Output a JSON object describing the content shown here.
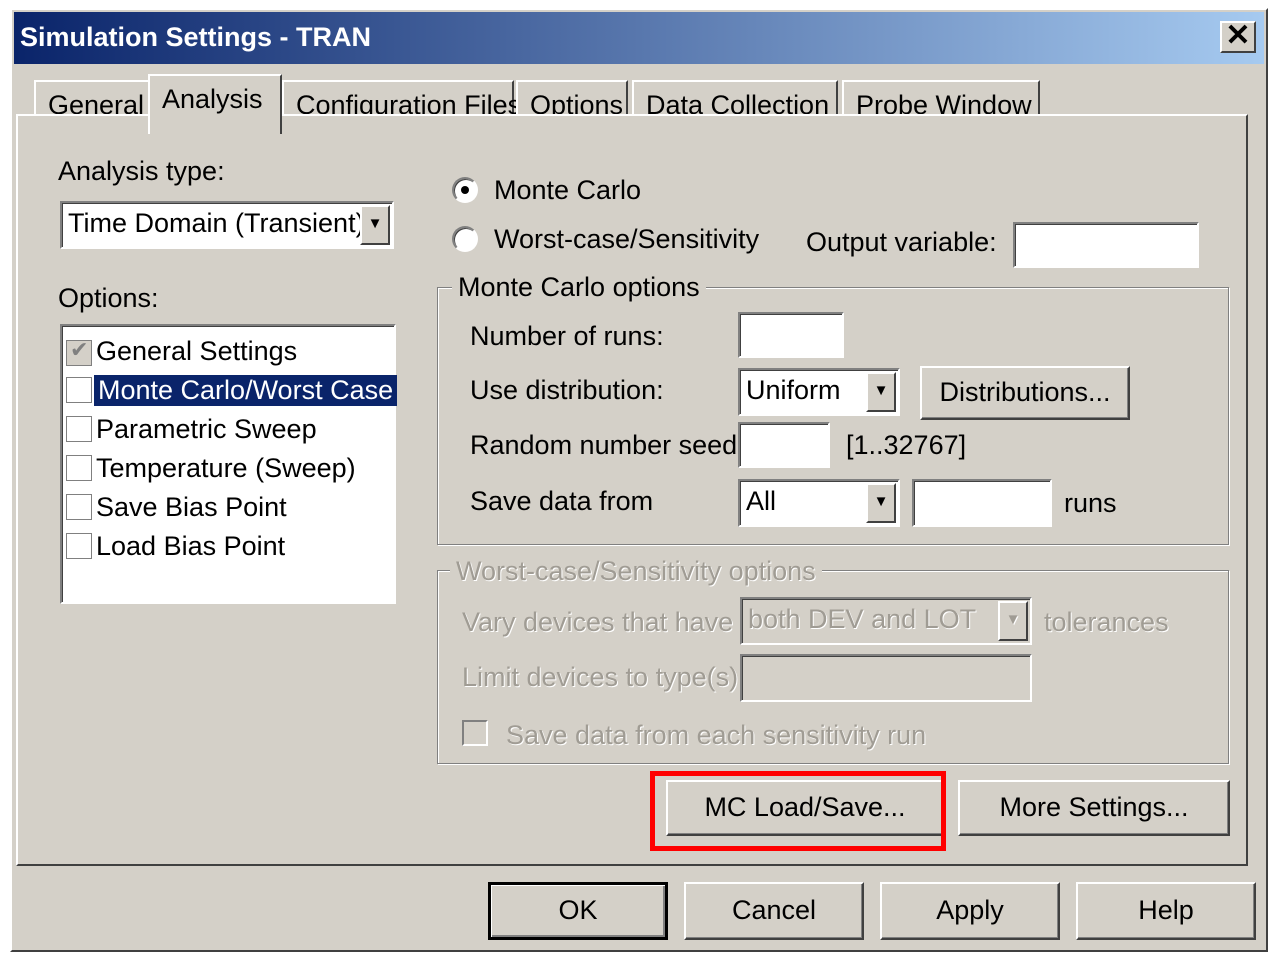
{
  "window": {
    "title": "Simulation Settings - TRAN",
    "close_glyph": "✕"
  },
  "tabs": [
    {
      "label": "General"
    },
    {
      "label": "Analysis",
      "active": true
    },
    {
      "label": "Configuration Files"
    },
    {
      "label": "Options"
    },
    {
      "label": "Data Collection"
    },
    {
      "label": "Probe Window"
    }
  ],
  "analysis_type": {
    "label": "Analysis type:",
    "value": "Time Domain (Transient)"
  },
  "options": {
    "label": "Options:",
    "items": [
      {
        "label": "General Settings",
        "checked": true,
        "disabled": true
      },
      {
        "label": "Monte Carlo/Worst Case",
        "checked": false,
        "selected": true
      },
      {
        "label": "Parametric Sweep",
        "checked": false
      },
      {
        "label": "Temperature (Sweep)",
        "checked": false
      },
      {
        "label": "Save Bias Point",
        "checked": false
      },
      {
        "label": "Load Bias Point",
        "checked": false
      }
    ]
  },
  "mode": {
    "monte_carlo": "Monte Carlo",
    "worst_case": "Worst-case/Sensitivity",
    "selected": "monte_carlo",
    "output_variable_label": "Output variable:",
    "output_variable_value": ""
  },
  "mc_options": {
    "legend": "Monte Carlo options",
    "runs_label": "Number of runs:",
    "runs_value": "",
    "distribution_label": "Use distribution:",
    "distribution_value": "Uniform",
    "distributions_button": "Distributions...",
    "seed_label": "Random number seed:",
    "seed_value": "",
    "seed_range": "[1..32767]",
    "save_label": "Save data from",
    "save_value": "All",
    "save_runs_value": "",
    "runs_suffix": "runs"
  },
  "wc_options": {
    "legend": "Worst-case/Sensitivity options",
    "vary_label": "Vary devices that have",
    "vary_value": "both DEV and LOT",
    "vary_suffix": "tolerances",
    "limit_label": "Limit devices to type(s):",
    "limit_value": "",
    "save_each_label": "Save data from each sensitivity run"
  },
  "panel_buttons": {
    "mc_load_save": "MC Load/Save...",
    "more_settings": "More Settings..."
  },
  "dialog_buttons": {
    "ok": "OK",
    "cancel": "Cancel",
    "apply": "Apply",
    "help": "Help"
  },
  "highlight_color": "#ff0000"
}
